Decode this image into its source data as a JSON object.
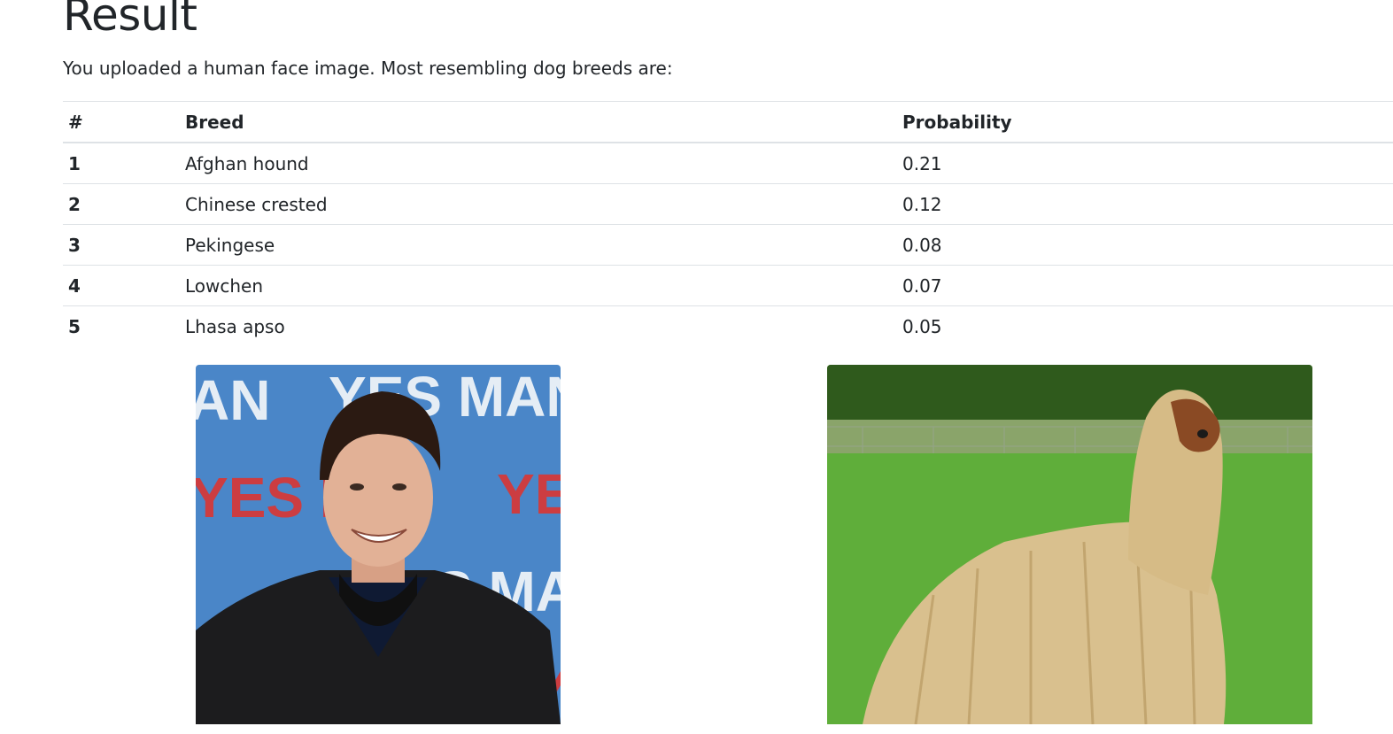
{
  "page": {
    "title": "Result",
    "message": "You uploaded a human face image. Most resembling dog breeds are:"
  },
  "table": {
    "headers": {
      "rank": "#",
      "breed": "Breed",
      "probability": "Probability"
    },
    "rows": [
      {
        "rank": "1",
        "breed": "Afghan hound",
        "probability": "0.21"
      },
      {
        "rank": "2",
        "breed": "Chinese crested",
        "probability": "0.12"
      },
      {
        "rank": "3",
        "breed": "Pekingese",
        "probability": "0.08"
      },
      {
        "rank": "4",
        "breed": "Lowchen",
        "probability": "0.07"
      },
      {
        "rank": "5",
        "breed": "Lhasa apso",
        "probability": "0.05"
      }
    ]
  },
  "images": {
    "uploaded": {
      "backdrop_text": [
        "AN",
        "YES MAN",
        "YES M",
        "YE",
        "S MAN",
        "YE"
      ],
      "backdrop_color": "#4a86c8"
    },
    "match": {
      "grass_color": "#5fae3a",
      "trees_color": "#2f5a1c"
    }
  }
}
